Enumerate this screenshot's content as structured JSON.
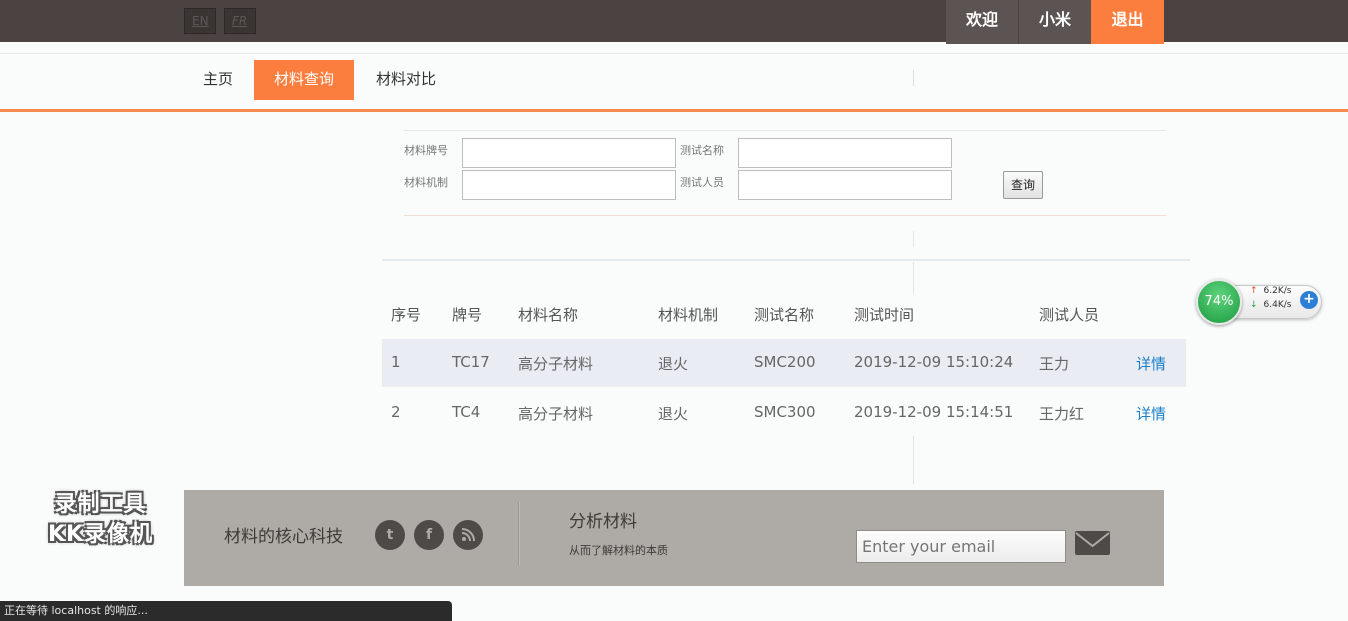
{
  "topbar": {
    "lang_en": "EN",
    "lang_fr": "FR",
    "welcome": "欢迎",
    "user": "小米",
    "logout": "退出"
  },
  "nav": {
    "home": "主页",
    "query": "材料查询",
    "compare": "材料对比"
  },
  "search": {
    "grade_label": "材料牌号",
    "test_name_label": "测试名称",
    "mechanism_label": "材料机制",
    "tester_label": "测试人员",
    "submit_label": "查询"
  },
  "table": {
    "headers": [
      "序号",
      "牌号",
      "材料名称",
      "材料机制",
      "测试名称",
      "测试时间",
      "测试人员"
    ],
    "rows": [
      {
        "no": "1",
        "grade": "TC17",
        "name": "高分子材料",
        "mechanism": "退火",
        "test": "SMC200",
        "time": "2019-12-09 15:10:24",
        "tester": "王力",
        "link": "详情"
      },
      {
        "no": "2",
        "grade": "TC4",
        "name": "高分子材料",
        "mechanism": "退火",
        "test": "SMC300",
        "time": "2019-12-09 15:14:51",
        "tester": "王力红",
        "link": "详情"
      }
    ]
  },
  "footer": {
    "title": "材料的核心科技",
    "social": {
      "twitter": "t",
      "facebook": "f",
      "rss": "ᐤ"
    },
    "heading": "分析材料",
    "subtitle": "从而了解材料的本质",
    "email_placeholder": "Enter your email"
  },
  "watermark": {
    "line1": "录制工具",
    "line2": "KK录像机"
  },
  "speed_widget": {
    "percent": "74%",
    "upload": "6.2K/s",
    "download": "6.4K/s",
    "plus": "+"
  },
  "status": {
    "text": "正在等待 localhost 的响应..."
  },
  "colors": {
    "accent": "#fb7e3e",
    "topbar": "#4a4342",
    "footer": "#aeaaa5",
    "link": "#1a7fc8"
  }
}
